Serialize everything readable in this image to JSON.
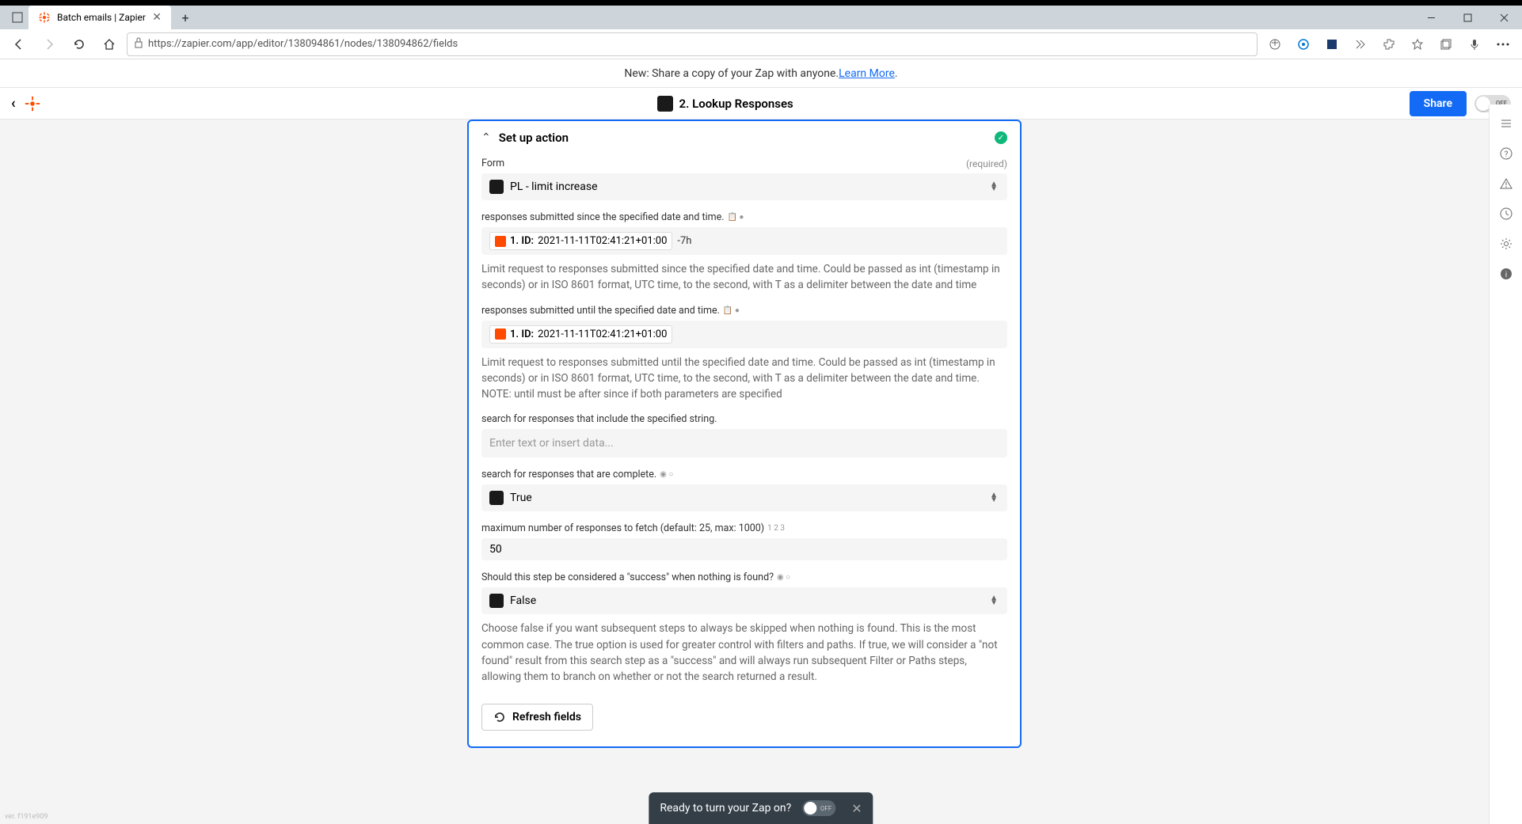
{
  "browser": {
    "tab_title": "Batch emails | Zapier",
    "url": "https://zapier.com/app/editor/138094861/nodes/138094862/fields"
  },
  "banner": {
    "text": "New: Share a copy of your Zap with anyone. ",
    "link": "Learn More"
  },
  "header": {
    "step_title": "2. Lookup Responses",
    "share": "Share",
    "toggle": "OFF"
  },
  "step": {
    "section_title": "Set up action",
    "form": {
      "label": "Form",
      "required": "(required)",
      "value": "PL - limit increase"
    },
    "since": {
      "label": "responses submitted since the specified date and time.",
      "token_prefix": "1. ID:",
      "token_value": "2021-11-11T02:41:21+01:00",
      "suffix": "-7h",
      "help": "Limit request to responses submitted since the specified date and time. Could be passed as int (timestamp in seconds) or in ISO 8601 format, UTC time, to the second, with T as a delimiter between the date and time"
    },
    "until": {
      "label": "responses submitted until the specified date and time.",
      "token_prefix": "1. ID:",
      "token_value": "2021-11-11T02:41:21+01:00",
      "help": "Limit request to responses submitted until the specified date and time. Could be passed as int (timestamp in seconds) or in ISO 8601 format, UTC time, to the second, with T as a delimiter between the date and time. NOTE: until must be after since if both parameters are specified"
    },
    "query": {
      "label": "search for responses that include the specified string.",
      "placeholder": "Enter text or insert data..."
    },
    "complete": {
      "label": "search for responses that are complete.",
      "value": "True"
    },
    "max": {
      "label": "maximum number of responses to fetch (default: 25, max: 1000)",
      "hint": "1 2 3",
      "value": "50"
    },
    "success": {
      "label": "Should this step be considered a \"success\" when nothing is found?",
      "value": "False",
      "help": "Choose false if you want subsequent steps to always be skipped when nothing is found. This is the most common case. The true option is used for greater control with filters and paths. If true, we will consider a \"not found\" result from this search step as a \"success\" and will always run subsequent Filter or Paths steps, allowing them to branch on whether or not the search returned a result."
    },
    "refresh": "Refresh fields"
  },
  "toast": {
    "text": "Ready to turn your Zap on?",
    "toggle": "OFF"
  },
  "version": "ver. f191e909"
}
